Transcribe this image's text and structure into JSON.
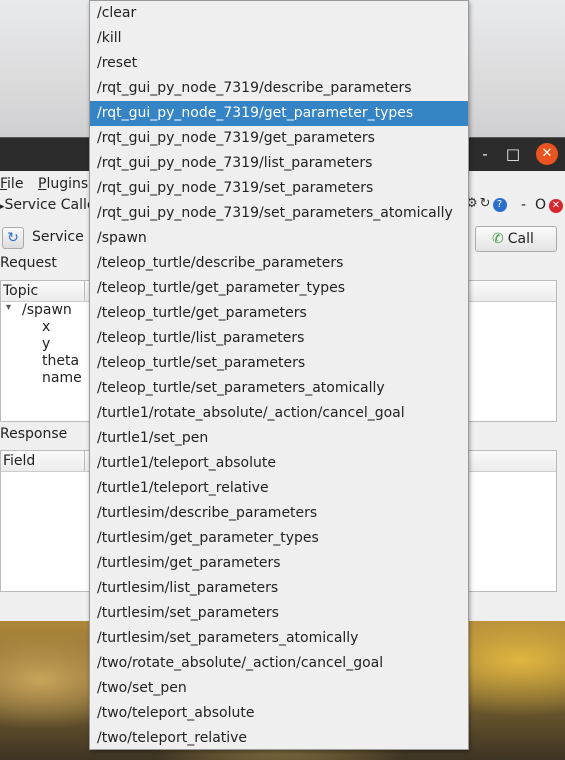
{
  "window": {
    "controls": {
      "minimize": "-",
      "maximize": "□",
      "close": "✕"
    },
    "menu": [
      "File",
      "Plugins"
    ],
    "plugin_title": "Service Calle",
    "plugin_controls": {
      "dash": "-",
      "o": "O",
      "close": "✕"
    }
  },
  "service": {
    "label": "Service",
    "call_button": "Call"
  },
  "request": {
    "label": "Request",
    "column_header": "Topic",
    "tree": [
      {
        "expander": "▾",
        "label": "/spawn"
      },
      {
        "label": "x"
      },
      {
        "label": "y"
      },
      {
        "label": "theta"
      },
      {
        "label": "name"
      }
    ]
  },
  "response": {
    "label": "Response",
    "column_header": "Field"
  },
  "dropdown": {
    "selected_index": 4,
    "items": [
      "/clear",
      "/kill",
      "/reset",
      "/rqt_gui_py_node_7319/describe_parameters",
      "/rqt_gui_py_node_7319/get_parameter_types",
      "/rqt_gui_py_node_7319/get_parameters",
      "/rqt_gui_py_node_7319/list_parameters",
      "/rqt_gui_py_node_7319/set_parameters",
      "/rqt_gui_py_node_7319/set_parameters_atomically",
      "/spawn",
      "/teleop_turtle/describe_parameters",
      "/teleop_turtle/get_parameter_types",
      "/teleop_turtle/get_parameters",
      "/teleop_turtle/list_parameters",
      "/teleop_turtle/set_parameters",
      "/teleop_turtle/set_parameters_atomically",
      "/turtle1/rotate_absolute/_action/cancel_goal",
      "/turtle1/set_pen",
      "/turtle1/teleport_absolute",
      "/turtle1/teleport_relative",
      "/turtlesim/describe_parameters",
      "/turtlesim/get_parameter_types",
      "/turtlesim/get_parameters",
      "/turtlesim/list_parameters",
      "/turtlesim/set_parameters",
      "/turtlesim/set_parameters_atomically",
      "/two/rotate_absolute/_action/cancel_goal",
      "/two/set_pen",
      "/two/teleport_absolute",
      "/two/teleport_relative"
    ]
  },
  "colors": {
    "selection": "#3584c6",
    "close_button": "#e95420"
  }
}
